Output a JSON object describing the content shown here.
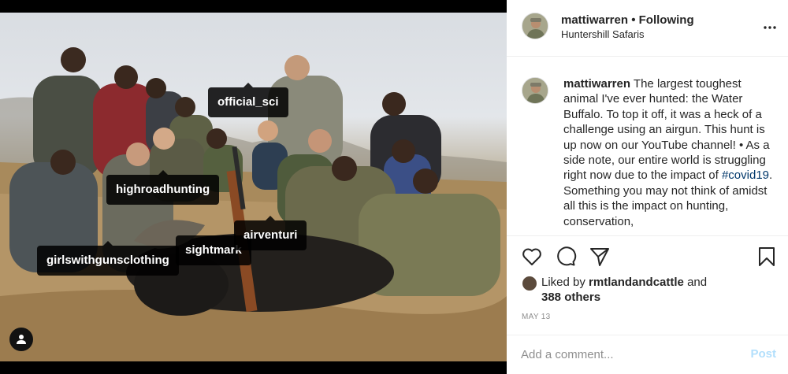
{
  "photo": {
    "tags": {
      "official_sci": "official_sci",
      "highroadhunting": "highroadhunting",
      "sightmark": "sightmark",
      "airventuri": "airventuri",
      "girlswithgunsclothing": "girlswithgunsclothing"
    },
    "user_tag_icon": "person-icon"
  },
  "header": {
    "username": "mattiwarren",
    "separator": " • ",
    "follow_status": "Following",
    "location": "Huntershill Safaris",
    "more_icon": "more-horizontal-icon"
  },
  "caption": {
    "username": "mattiwarren",
    "text_before_tag": " The largest toughest animal I've ever hunted: the Water Buffalo. To top it off, it was a heck of a challenge using an airgun. This hunt is up now on our YouTube channel! • As a side note, our entire world is struggling right now due to the impact of ",
    "hashtag": "#covid19",
    "text_after_tag": ". Something you may not think of amidst all this is the impact on hunting, conservation,"
  },
  "actions": {
    "like_icon": "heart-icon",
    "comment_icon": "comment-bubble-icon",
    "share_icon": "paper-plane-icon",
    "save_icon": "bookmark-icon"
  },
  "likes": {
    "prefix": "Liked by ",
    "user": "rmtlandandcattle",
    "conjunction": " and",
    "others": "388 others"
  },
  "date": "MAY 13",
  "comment": {
    "placeholder": "Add a comment...",
    "post_label": "Post"
  },
  "colors": {
    "hashtag": "#00376b",
    "post_button_disabled": "#b2dffc",
    "meta_text": "#8e8e8e"
  }
}
